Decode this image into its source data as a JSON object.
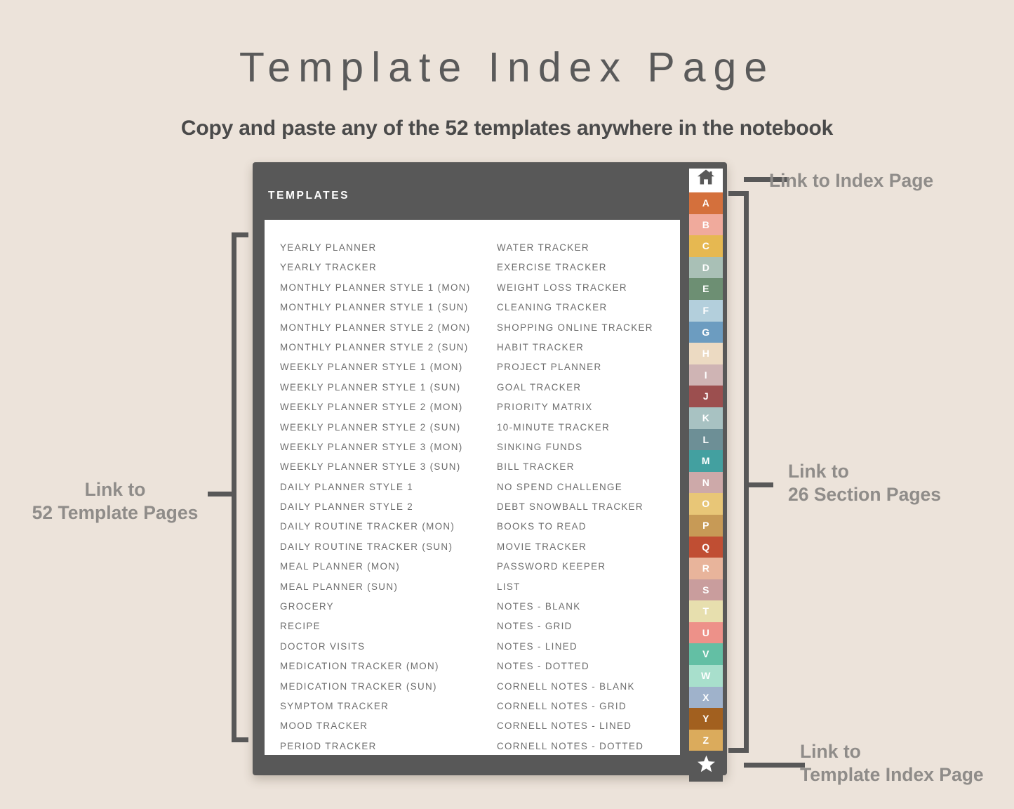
{
  "header": {
    "title": "Template Index Page",
    "subtitle": "Copy and paste any of the 52 templates anywhere in the notebook"
  },
  "notebook": {
    "heading": "TEMPLATES",
    "templates_left": [
      "YEARLY PLANNER",
      "YEARLY TRACKER",
      "MONTHLY PLANNER STYLE 1 (MON)",
      "MONTHLY PLANNER STYLE 1 (SUN)",
      "MONTHLY PLANNER STYLE 2 (MON)",
      "MONTHLY PLANNER STYLE 2 (SUN)",
      "WEEKLY PLANNER STYLE 1 (MON)",
      "WEEKLY PLANNER STYLE 1 (SUN)",
      "WEEKLY PLANNER STYLE 2 (MON)",
      "WEEKLY PLANNER STYLE 2 (SUN)",
      "WEEKLY PLANNER STYLE 3 (MON)",
      "WEEKLY PLANNER STYLE 3 (SUN)",
      "DAILY PLANNER STYLE 1",
      "DAILY PLANNER STYLE 2",
      "DAILY ROUTINE TRACKER (MON)",
      "DAILY ROUTINE TRACKER (SUN)",
      "MEAL PLANNER (MON)",
      "MEAL PLANNER (SUN)",
      "GROCERY",
      "RECIPE",
      "DOCTOR VISITS",
      "MEDICATION TRACKER (MON)",
      "MEDICATION TRACKER (SUN)",
      "SYMPTOM TRACKER",
      "MOOD TRACKER",
      "PERIOD TRACKER"
    ],
    "templates_right": [
      "WATER TRACKER",
      "EXERCISE TRACKER",
      "WEIGHT LOSS TRACKER",
      "CLEANING TRACKER",
      "SHOPPING ONLINE TRACKER",
      "HABIT TRACKER",
      "PROJECT PLANNER",
      "GOAL TRACKER",
      "PRIORITY MATRIX",
      "10-MINUTE TRACKER",
      "SINKING FUNDS",
      "BILL TRACKER",
      "NO SPEND CHALLENGE",
      "DEBT SNOWBALL TRACKER",
      "BOOKS TO READ",
      "MOVIE TRACKER",
      "PASSWORD KEEPER",
      "LIST",
      "NOTES - BLANK",
      "NOTES - GRID",
      "NOTES - LINED",
      "NOTES - DOTTED",
      "CORNELL NOTES - BLANK",
      "CORNELL NOTES - GRID",
      "CORNELL NOTES - LINED",
      "CORNELL NOTES - DOTTED"
    ],
    "tabs": [
      {
        "label": "",
        "icon": "home-icon",
        "color": "#ffffff"
      },
      {
        "label": "A",
        "color": "#d4703c"
      },
      {
        "label": "B",
        "color": "#f0aa9c"
      },
      {
        "label": "C",
        "color": "#e6b851"
      },
      {
        "label": "D",
        "color": "#a9c0b6"
      },
      {
        "label": "E",
        "color": "#6d8f73"
      },
      {
        "label": "F",
        "color": "#b3cfdc"
      },
      {
        "label": "G",
        "color": "#6c9cc0"
      },
      {
        "label": "H",
        "color": "#ecdac2"
      },
      {
        "label": "I",
        "color": "#cfb4b4"
      },
      {
        "label": "J",
        "color": "#9c4f4f"
      },
      {
        "label": "K",
        "color": "#a8c2c2"
      },
      {
        "label": "L",
        "color": "#6d8f96"
      },
      {
        "label": "M",
        "color": "#43a0a0"
      },
      {
        "label": "N",
        "color": "#cda9a9"
      },
      {
        "label": "O",
        "color": "#e8c677"
      },
      {
        "label": "P",
        "color": "#c79a56"
      },
      {
        "label": "Q",
        "color": "#c04e33"
      },
      {
        "label": "R",
        "color": "#e8b49b"
      },
      {
        "label": "S",
        "color": "#c99d9d"
      },
      {
        "label": "T",
        "color": "#e7dfae"
      },
      {
        "label": "U",
        "color": "#ed9189"
      },
      {
        "label": "V",
        "color": "#63bfa4"
      },
      {
        "label": "W",
        "color": "#a8dfcc"
      },
      {
        "label": "X",
        "color": "#9fb2cb"
      },
      {
        "label": "Y",
        "color": "#a2601f"
      },
      {
        "label": "Z",
        "color": "#dbab5c"
      },
      {
        "label": "",
        "icon": "star-icon",
        "color": "#585858"
      }
    ]
  },
  "callouts": {
    "index_page": "Link to Index Page",
    "section_pages": "Link to\n26 Section Pages",
    "template_index_page": "Link to\nTemplate Index Page",
    "template_pages": "Link to\n52 Template Pages"
  }
}
